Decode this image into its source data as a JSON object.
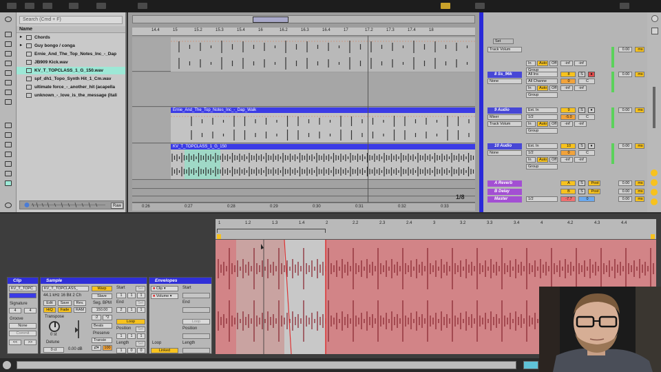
{
  "browser": {
    "search_placeholder": "Search (Cmd + F)",
    "name_header": "Name",
    "items": [
      {
        "label": "Chords",
        "type": "folder"
      },
      {
        "label": "Guy bongo / conga",
        "type": "folder"
      },
      {
        "label": "Ernie_And_The_Top_Notes_Inc_-_Dap",
        "type": "file"
      },
      {
        "label": "JB909 Kick.wav",
        "type": "file"
      },
      {
        "label": "KV_T_TOPCLASS_1_G_150.wav",
        "type": "file",
        "selected": true
      },
      {
        "label": "spf_dh1_Topo_Synth Hit_1_Cm.wav",
        "type": "file"
      },
      {
        "label": "ultimate force_-_another_hit (acapella",
        "type": "file"
      },
      {
        "label": "unknown_-_love_is_the_message (itali",
        "type": "file"
      }
    ],
    "raw_button": "Raw"
  },
  "arrangement": {
    "ruler_ticks": [
      "14.4",
      "15",
      "15.2",
      "15.3",
      "15.4",
      "16",
      "16.2",
      "16.3",
      "16.4",
      "17",
      "17.2",
      "17.3",
      "17.4",
      "18"
    ],
    "time_ticks": [
      "0:26",
      "0:27",
      "0:28",
      "0:29",
      "0:30",
      "0:31",
      "0:32",
      "0:33"
    ],
    "page_indicator": "1/8",
    "clips": [
      {
        "name": "",
        "track": "8 Ss_96k"
      },
      {
        "name": "Ernie_And_The_Top_Notes_Inc_-_Dap_Walk",
        "track": "9 Audio"
      },
      {
        "name": "KV_T_TOPCLASS_1_G_150",
        "track": "10 Audio"
      }
    ]
  },
  "mixer": {
    "set_label": "Set",
    "tracks": [
      {
        "name": "",
        "input_type": "Track Volum",
        "group": "Group",
        "in": "In",
        "auto": "Auto",
        "off": "Off",
        "send1": "-inf",
        "send2": "-inf",
        "num": "",
        "vol": "",
        "pan": "",
        "level": "0.00",
        "ms": "ms"
      },
      {
        "name": "8 Ss_96k",
        "input_type": "All Ins",
        "input_channel": "All Channe",
        "monitor": "None",
        "group": "Group",
        "in": "In",
        "auto": "Auto",
        "off": "Off",
        "send1": "-inf",
        "send2": "-inf",
        "num": "8",
        "vol": "0",
        "pan": "C",
        "level": "0.00",
        "ms": "ms"
      },
      {
        "name": "9 Audio",
        "input_type": "Ext. In",
        "input_channel": "1/2",
        "monitor": "Mixer",
        "sub": "Track Volum",
        "group": "Group",
        "in": "In",
        "auto": "Auto",
        "off": "Off",
        "send1": "-inf",
        "send2": "-inf",
        "num": "9",
        "vol": "-5.0",
        "pan": "C",
        "level": "0.00",
        "ms": "ms"
      },
      {
        "name": "10 Audio",
        "input_type": "Ext. In",
        "input_channel": "1/2",
        "monitor": "None",
        "group": "Group",
        "in": "In",
        "auto": "Auto",
        "off": "Off",
        "send1": "-inf",
        "send2": "-inf",
        "num": "10",
        "vol": "0",
        "pan": "C",
        "level": "0.00",
        "ms": "ms"
      }
    ],
    "returns": [
      {
        "name": "A Reverb",
        "letter": "A",
        "post": "Post",
        "level": "0.00",
        "ms": "ms"
      },
      {
        "name": "B Delay",
        "letter": "B",
        "post": "Post",
        "level": "0.00",
        "ms": "ms"
      },
      {
        "name": "Master",
        "letter": "",
        "channel": "1/2",
        "vol": "-7.7",
        "pan": "0",
        "level": "0.00",
        "ms": "ms"
      }
    ]
  },
  "clip_panel": {
    "title": "Clip",
    "name": "KV_T_TOPC",
    "signature_label": "Signature",
    "sig_num": "4",
    "sig_den": "4",
    "groove_label": "Groove",
    "groove_value": "None",
    "commit": "Commit"
  },
  "sample_panel": {
    "title": "Sample",
    "filename": "KV_T_TOPCLASS_",
    "info": "44.1 kHz 16 Bit 2 Ch",
    "edit": "Edit",
    "save": "Save",
    "rev": "Rev.",
    "hiq": "HiQ",
    "fade": "Fade",
    "ram": "RAM",
    "transpose_label": "Transpose",
    "transpose_value": "0 st",
    "detune_label": "Detune",
    "detune_value": "0 ct",
    "gain": "0.00 dB",
    "warp": "Warp",
    "slave": "Slave",
    "seg_bpm_label": "Seg. BPM",
    "seg_bpm": "150.00",
    "half": ":2",
    "double": "*2",
    "warp_mode": "Beats",
    "preserve_label": "Preserve",
    "preserve_value": "Transie",
    "loop_value": "100",
    "start_label": "Start",
    "end_label": "End",
    "loop_label": "Loop",
    "position_label": "Position",
    "length_label": "Length",
    "set": "Set"
  },
  "envelopes_panel": {
    "title": "Envelopes",
    "device": "Clip",
    "parameter": "Volume",
    "start_label": "Start",
    "end_label": "End",
    "loop_btn": "Loop",
    "position_label": "Position",
    "length_label": "Length",
    "loop_label": "Loop",
    "linked": "Linked"
  },
  "sample_editor": {
    "ruler_ticks": [
      "1",
      "1.2",
      "1.3",
      "1.4",
      "2",
      "2.2",
      "2.3",
      "2.4",
      "3",
      "3.2",
      "3.3",
      "3.4",
      "4",
      "4.2",
      "4.3",
      "4.4"
    ]
  },
  "colors": {
    "clip_blue": "#3b3be6",
    "selected_row": "#9de8d6",
    "waveform_bg": "#d28487",
    "warp_yellow": "#f7c21e",
    "return_purple": "#a34fd3"
  }
}
